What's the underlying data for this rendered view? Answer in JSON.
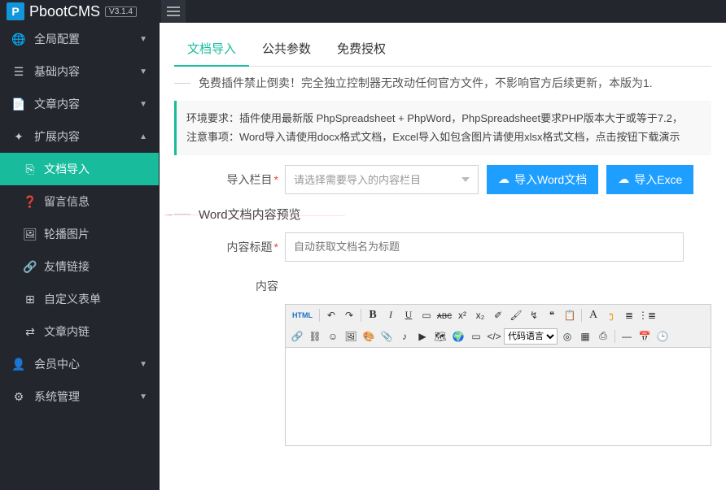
{
  "brand": {
    "name": "PbootCMS",
    "version": "V3.1.4",
    "logo_letter": "P"
  },
  "sidebar": {
    "items": [
      {
        "icon": "globe",
        "label": "全局配置",
        "expanded": false
      },
      {
        "icon": "sliders",
        "label": "基础内容",
        "expanded": false
      },
      {
        "icon": "file",
        "label": "文章内容",
        "expanded": false
      },
      {
        "icon": "puzzle",
        "label": "扩展内容",
        "expanded": true,
        "children": [
          {
            "icon": "copy",
            "label": "文档导入",
            "active": true
          },
          {
            "icon": "question",
            "label": "留言信息"
          },
          {
            "icon": "image",
            "label": "轮播图片"
          },
          {
            "icon": "link",
            "label": "友情链接"
          },
          {
            "icon": "plus-box",
            "label": "自定义表单"
          },
          {
            "icon": "shuffle",
            "label": "文章内链"
          }
        ]
      },
      {
        "icon": "user",
        "label": "会员中心",
        "expanded": false
      },
      {
        "icon": "gear",
        "label": "系统管理",
        "expanded": false
      }
    ]
  },
  "tabs": [
    {
      "label": "文档导入",
      "active": true
    },
    {
      "label": "公共参数"
    },
    {
      "label": "免费授权"
    }
  ],
  "warning": "免费插件禁止倒卖！完全独立控制器无改动任何官方文件，不影响官方后续更新，本版为1.",
  "info": {
    "line1": "环境要求：插件使用最新版 PhpSpreadsheet + PhpWord，PhpSpreadsheet要求PHP版本大于或等于7.2，",
    "line2": "注意事项：Word导入请使用docx格式文档，Excel导入如包含图片请使用xlsx格式文档，点击按钮下载演示"
  },
  "form": {
    "column_label": "导入栏目",
    "column_placeholder": "请选择需要导入的内容栏目",
    "btn_word": "导入Word文档",
    "btn_excel": "导入Exce",
    "section_preview": "Word文档内容预览",
    "title_label": "内容标题",
    "title_placeholder": "自动获取文档名为标题",
    "content_label": "内容"
  },
  "editor_toolbar": {
    "html": "HTML",
    "code_lang": "代码语言",
    "letters": {
      "B": "B",
      "I": "I",
      "U": "U",
      "A": "A"
    }
  }
}
